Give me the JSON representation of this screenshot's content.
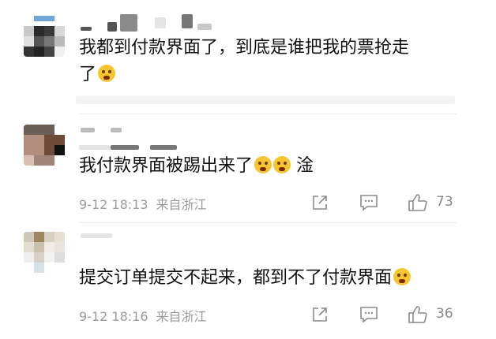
{
  "comments": [
    {
      "text": "我都到付款界面了，到底是谁把我的票抢走",
      "text_line2": "了"
    },
    {
      "text": "我付款界面被踢出来了",
      "text_tail": "淦",
      "time": "9-12 18:13",
      "location": "来自浙江",
      "likes": "73"
    },
    {
      "text": "提交订单提交不起来，都到不了付款界面",
      "time": "9-12 18:16",
      "location": "来自浙江",
      "likes": "36"
    }
  ],
  "icons": {
    "share": "share-icon",
    "comment": "comment-icon",
    "like": "thumbs-up-icon",
    "emoji_cry": "crying-face-emoji",
    "emoji_scream": "screaming-face-emoji"
  },
  "colors": {
    "text": "#111111",
    "meta": "#9b9b9b",
    "emoji": "#f7c531"
  }
}
